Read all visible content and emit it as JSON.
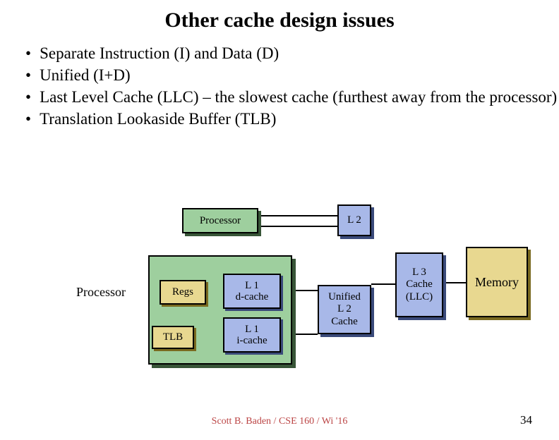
{
  "title": "Other cache design issues",
  "bullets": [
    "Separate Instruction (I) and Data (D)",
    "Unified (I+D)",
    "Last  Level Cache (LLC) – the slowest cache (furthest away from the processor)",
    "Translation Lookaside Buffer (TLB)"
  ],
  "diagram": {
    "proc_top": "Processor",
    "l2": "L 2",
    "proc_label": "Processor",
    "regs": "Regs",
    "tlb": "TLB",
    "l1d": "L 1\nd-cache",
    "l1i": "L 1\ni-cache",
    "ul2": "Unified\nL 2\nCache",
    "l3": "L 3\nCache\n(LLC)",
    "memory": "Memory"
  },
  "footer": {
    "credit": "Scott B. Baden / CSE 160 / Wi '16",
    "page": "34"
  }
}
